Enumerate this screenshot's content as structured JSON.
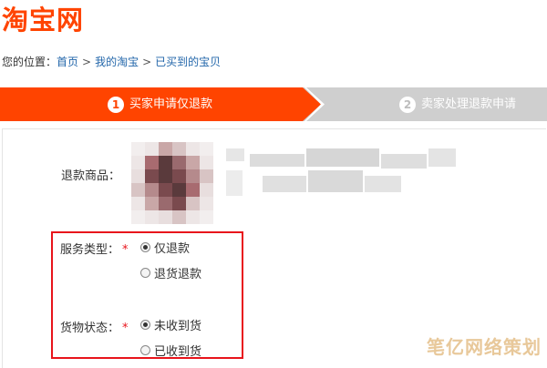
{
  "logo": {
    "text": "淘宝网",
    "color": "#ff4400"
  },
  "breadcrumb": {
    "prefix": "您的位置：",
    "items": [
      "首页",
      "我的淘宝",
      "已买到的宝贝"
    ],
    "separator": ">"
  },
  "steps": [
    {
      "num": "1",
      "label": "买家申请仅退款",
      "active": true
    },
    {
      "num": "2",
      "label": "卖家处理退款申请",
      "active": false
    }
  ],
  "form": {
    "goods_label": "退款商品：",
    "service_type": {
      "label": "服务类型：",
      "required_mark": "*",
      "options": [
        {
          "label": "仅退款",
          "checked": true
        },
        {
          "label": "退货退款",
          "checked": false
        }
      ]
    },
    "goods_status": {
      "label": "货物状态：",
      "required_mark": "*",
      "options": [
        {
          "label": "未收到货",
          "checked": true
        },
        {
          "label": "已收到货",
          "checked": false
        }
      ]
    }
  },
  "watermark": "笔亿网络策划",
  "colors": {
    "accent": "#ff4400",
    "highlight_border": "#e8141b",
    "link": "#2266aa"
  }
}
